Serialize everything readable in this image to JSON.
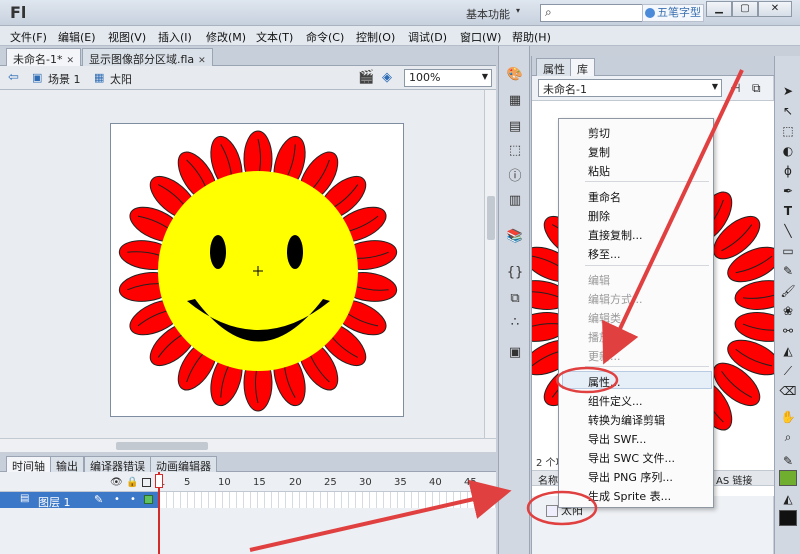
{
  "app": {
    "logo": "Fl",
    "workspace": "基本功能",
    "watermark": "五笔字型"
  },
  "menubar": [
    "文件(F)",
    "编辑(E)",
    "视图(V)",
    "插入(I)",
    "修改(M)",
    "文本(T)",
    "命令(C)",
    "控制(O)",
    "调试(D)",
    "窗口(W)",
    "帮助(H)"
  ],
  "doc_tabs": [
    {
      "label": "未命名-1*",
      "active": true
    },
    {
      "label": "显示图像部分区域.fla",
      "active": false
    }
  ],
  "editbar": {
    "scene": "场景 1",
    "symbol": "太阳",
    "zoom": "100%"
  },
  "timeline": {
    "tabs": [
      "时间轴",
      "输出",
      "编译器错误",
      "动画编辑器"
    ],
    "frame_numbers": [
      "1",
      "5",
      "10",
      "15",
      "20",
      "25",
      "30",
      "35",
      "40",
      "45"
    ],
    "layer_name": "图层 1"
  },
  "library": {
    "tabs": [
      "属性",
      "库"
    ],
    "document": "未命名-1",
    "count_text": "2 个项",
    "col_name": "名称",
    "col_link": "AS 链接",
    "item": "太阳"
  },
  "context_menu": {
    "items": [
      {
        "label": "剪切",
        "disabled": false
      },
      {
        "label": "复制",
        "disabled": false
      },
      {
        "label": "粘贴",
        "disabled": false
      },
      {
        "label": "重命名",
        "disabled": false
      },
      {
        "label": "删除",
        "disabled": false
      },
      {
        "label": "直接复制...",
        "disabled": false
      },
      {
        "label": "移至...",
        "disabled": false
      },
      {
        "label": "编辑",
        "disabled": true
      },
      {
        "label": "编辑方式...",
        "disabled": true
      },
      {
        "label": "编辑类",
        "disabled": true
      },
      {
        "label": "播放",
        "disabled": true
      },
      {
        "label": "更新...",
        "disabled": true
      },
      {
        "label": "属性...",
        "disabled": false
      },
      {
        "label": "组件定义...",
        "disabled": false
      },
      {
        "label": "转换为编译剪辑",
        "disabled": false
      },
      {
        "label": "导出 SWF...",
        "disabled": false
      },
      {
        "label": "导出 SWC 文件...",
        "disabled": false
      },
      {
        "label": "导出 PNG 序列...",
        "disabled": false
      },
      {
        "label": "生成 Sprite 表...",
        "disabled": false
      }
    ],
    "highlighted": "属性..."
  },
  "colors": {
    "sun_face": "#ffff00",
    "sun_petals": "#ff0000",
    "annotation": "#e04040",
    "stroke_swatch": "#6fae2e",
    "fill_swatch": "#111111"
  }
}
